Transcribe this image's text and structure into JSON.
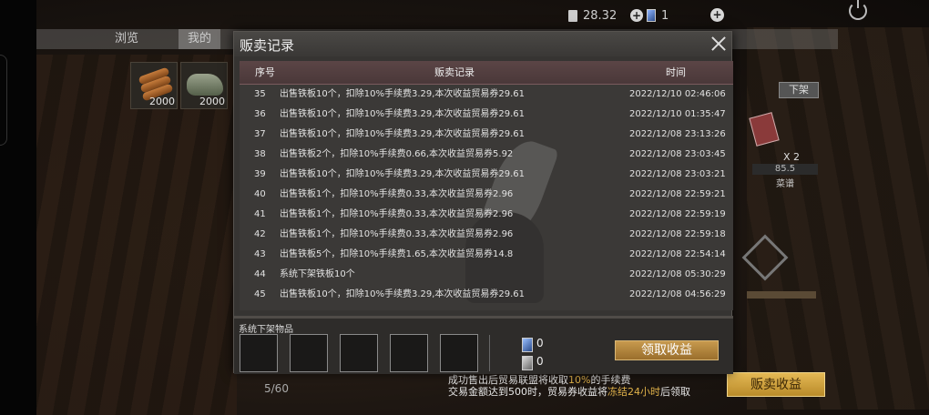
{
  "hud": {
    "balance": "28.32",
    "cards": "1"
  },
  "bg_tabs": {
    "browse": "浏览",
    "mine": "我的"
  },
  "inventory": [
    {
      "icon": "wood-log-icon",
      "qty": "2000"
    },
    {
      "icon": "iron-ore-icon",
      "qty": "2000"
    }
  ],
  "right_panel": {
    "unlist_label": "下架",
    "count": "X 2",
    "value": "85.5",
    "name": "菜谱"
  },
  "bg_count": "5/60",
  "notice": {
    "line1_a": "成功售出后贸易联盟将收取",
    "line1_pct": "10%",
    "line1_b": "的手续费",
    "line2_a": "交易金额达到500时，贸易券收益将",
    "line2_hl": "冻结24小时",
    "line2_b": "后领取"
  },
  "sell_income_button": "贩卖收益",
  "modal": {
    "title": "贩卖记录",
    "columns": {
      "no": "序号",
      "record": "贩卖记录",
      "time": "时间"
    },
    "rows": [
      {
        "no": "35",
        "record": "出售铁板10个，扣除10%手续费3.29,本次收益贸易券29.61",
        "time": "2022/12/10 02:46:06"
      },
      {
        "no": "36",
        "record": "出售铁板10个，扣除10%手续费3.29,本次收益贸易券29.61",
        "time": "2022/12/10 01:35:47"
      },
      {
        "no": "37",
        "record": "出售铁板10个，扣除10%手续费3.29,本次收益贸易券29.61",
        "time": "2022/12/08 23:13:26"
      },
      {
        "no": "38",
        "record": "出售铁板2个，扣除10%手续费0.66,本次收益贸易券5.92",
        "time": "2022/12/08 23:03:45"
      },
      {
        "no": "39",
        "record": "出售铁板10个，扣除10%手续费3.29,本次收益贸易券29.61",
        "time": "2022/12/08 23:03:21"
      },
      {
        "no": "40",
        "record": "出售铁板1个，扣除10%手续费0.33,本次收益贸易券2.96",
        "time": "2022/12/08 22:59:21"
      },
      {
        "no": "41",
        "record": "出售铁板1个，扣除10%手续费0.33,本次收益贸易券2.96",
        "time": "2022/12/08 22:59:19"
      },
      {
        "no": "42",
        "record": "出售铁板1个，扣除10%手续费0.33,本次收益贸易券2.96",
        "time": "2022/12/08 22:59:18"
      },
      {
        "no": "43",
        "record": "出售铁板5个，扣除10%手续费1.65,本次收益贸易券14.8",
        "time": "2022/12/08 22:54:14"
      },
      {
        "no": "44",
        "record": "系统下架铁板10个",
        "time": "2022/12/08 05:30:29"
      },
      {
        "no": "45",
        "record": "出售铁板10个，扣除10%手续费3.29,本次收益贸易券29.61",
        "time": "2022/12/08 04:56:29"
      }
    ],
    "footer": {
      "label": "系统下架物品",
      "trade_ticket_value": "0",
      "card_value": "0",
      "claim_button": "领取收益"
    }
  }
}
